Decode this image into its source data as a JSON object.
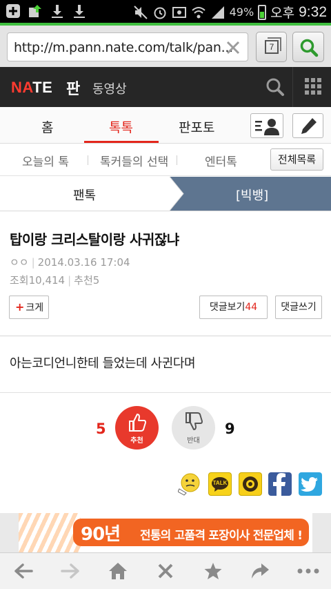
{
  "status_bar": {
    "battery_percent": "49%",
    "ampm": "오후",
    "time": "9:32",
    "icons": [
      "add-icon",
      "upload-icon",
      "download-icon",
      "download-icon",
      "mute-icon",
      "alarm-icon",
      "screenshot-icon",
      "wifi-icon",
      "signal-icon",
      "battery-icon"
    ]
  },
  "browser": {
    "url": "http://m.pann.nate.com/talk/pan...",
    "tab_count": "7",
    "accent_color": "#3fbf3f"
  },
  "nate_header": {
    "logo_na": "NA",
    "logo_te": "TE",
    "section": "판",
    "video_link": "동영상"
  },
  "main_tabs": {
    "items": [
      {
        "label": "홈"
      },
      {
        "label": "톡톡"
      },
      {
        "label": "판포토"
      }
    ],
    "active_index": 1,
    "accent_color": "#e3261c"
  },
  "sub_tabs": {
    "items": [
      {
        "label": "오늘의 톡"
      },
      {
        "label": "톡커들의 선택"
      },
      {
        "label": "엔터톡"
      }
    ],
    "all_list_label": "전체목록"
  },
  "breadcrumb": {
    "left": "팬톡",
    "right": "[빅뱅]"
  },
  "article": {
    "title": "탑이랑 크리스탈이랑 사귀잖냐",
    "author": "ㅇㅇ",
    "date": "2014.03.16 17:04",
    "views_label": "조회",
    "views": "10,414",
    "recommend_label": "추천",
    "recommend": "5",
    "bigger_label": "크게",
    "view_comments_label": "댓글보기",
    "comment_count": "44",
    "write_comment_label": "댓글쓰기",
    "body": "아는코디언니한테 들었는데 사귄다며"
  },
  "votes": {
    "up_count": "5",
    "up_label": "추천",
    "down_label": "반대",
    "down_count": "9"
  },
  "share": {
    "kakao_label": "TALK"
  },
  "ad": {
    "years": "90년",
    "text": "전통의 고품격 포장이사 전문업체 !"
  }
}
